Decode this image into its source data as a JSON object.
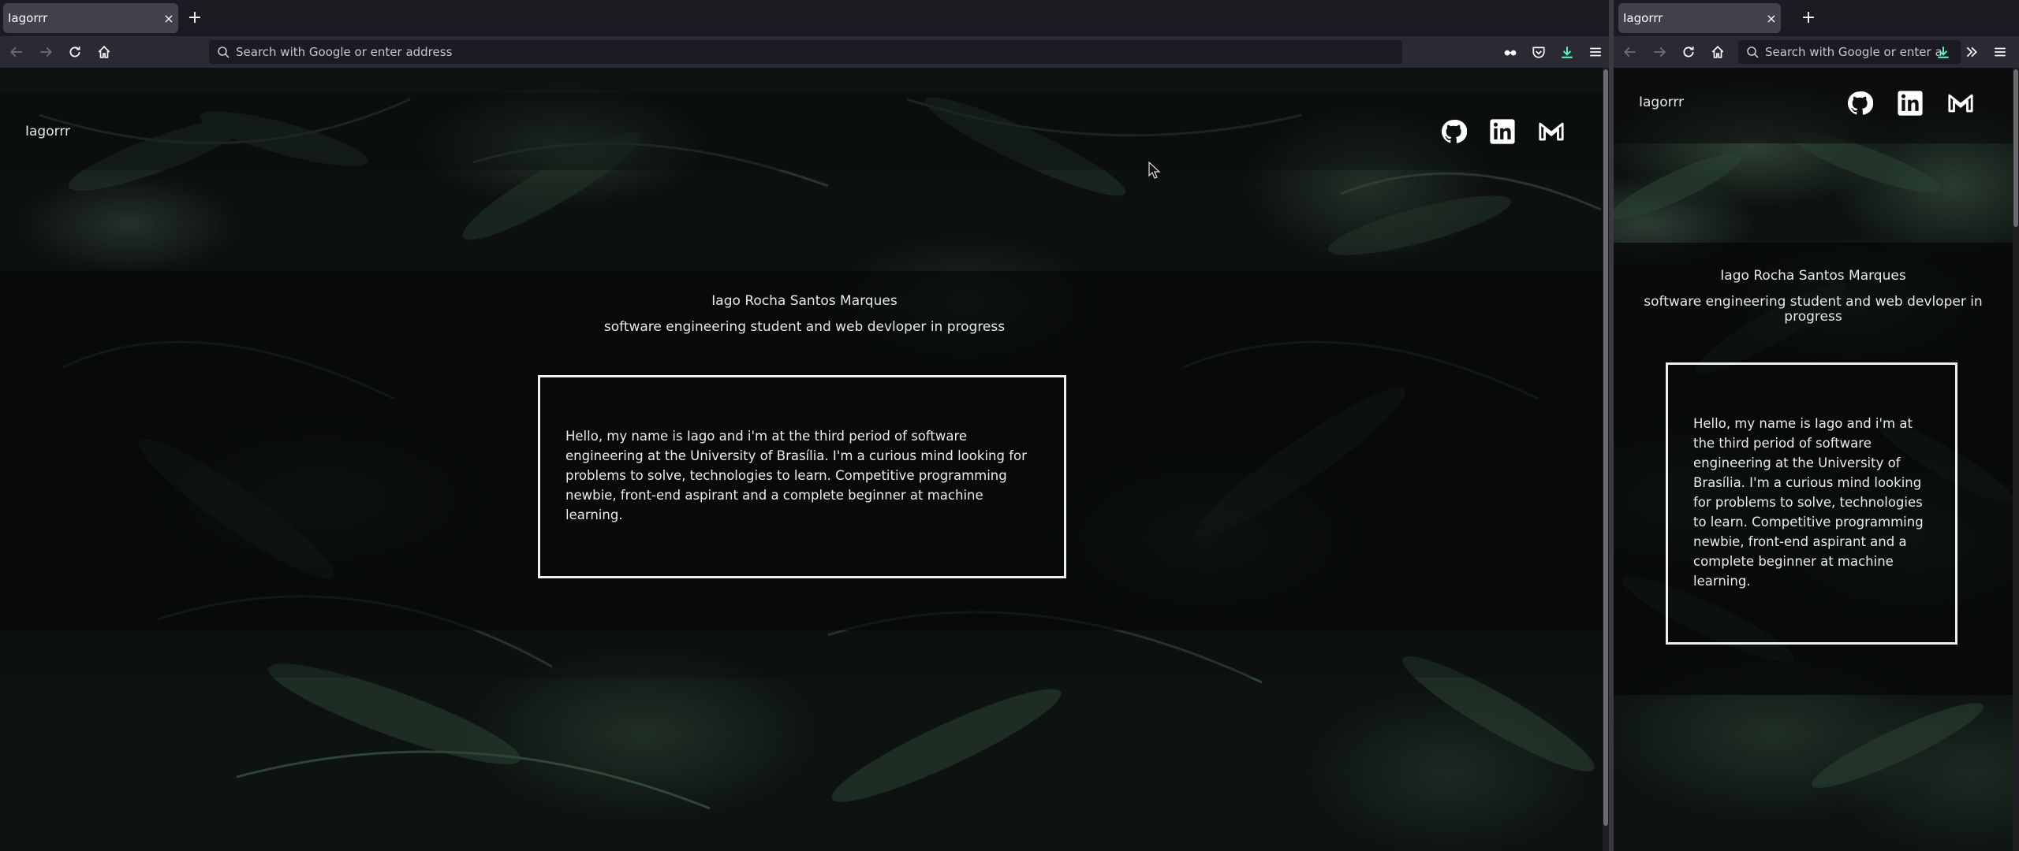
{
  "browser": {
    "tab_title": "Iagorrr",
    "tab_close": "×",
    "new_tab": "+",
    "url_placeholder_left": "Search with Google or enter address",
    "url_placeholder_right": "Search with Google or enter a"
  },
  "site": {
    "brand": "Iagorrr",
    "name": "Iago Rocha Santos Marques",
    "subtitle": "software engineering student and web devloper in progress",
    "bio": "Hello, my name is Iago and i'm at the third period of software engineering at the University of Brasília. I'm a curious mind looking for problems to solve, technologies to learn. Competitive programming newbie, front-end aspirant and a complete beginner at machine learning.",
    "socials": [
      "github-icon",
      "linkedin-icon",
      "gmail-icon"
    ]
  },
  "colors": {
    "toolbar": "#2b2a33",
    "tabbar": "#1c1b22",
    "accent_download": "#54ffbd",
    "text": "#e8e8e8"
  }
}
